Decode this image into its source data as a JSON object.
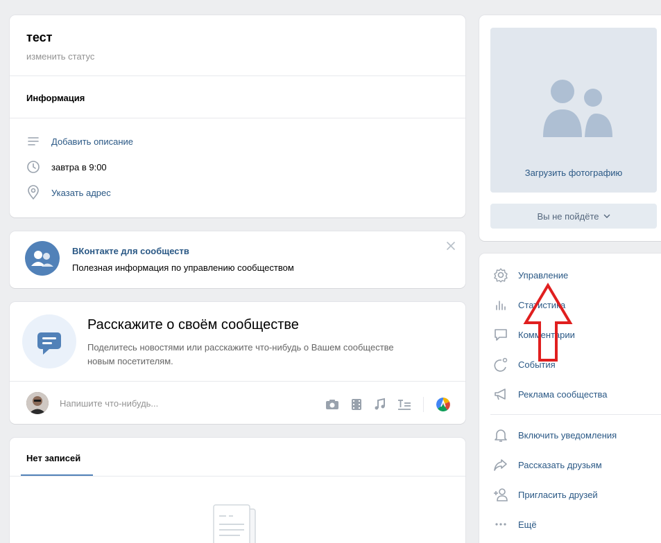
{
  "profile": {
    "name": "тест",
    "status_link": "изменить статус"
  },
  "info": {
    "header": "Информация",
    "add_description": "Добавить описание",
    "time": "завтра в 9:00",
    "add_address": "Указать адрес"
  },
  "promo": {
    "title": "ВКонтакте для сообществ",
    "subtitle": "Полезная информация по управлению сообществом"
  },
  "tell": {
    "title": "Расскажите о своём сообществе",
    "description": "Поделитесь новостями или расскажите что-нибудь о Вашем сообществе новым посетителям.",
    "composer_placeholder": "Напишите что-нибудь..."
  },
  "posts": {
    "tab_label": "Нет записей"
  },
  "photo": {
    "upload_label": "Загрузить фотографию",
    "attend_button": "Вы не пойдёте"
  },
  "menu": {
    "items": [
      {
        "label": "Управление",
        "icon": "gear-icon"
      },
      {
        "label": "Статистика",
        "icon": "stats-icon"
      },
      {
        "label": "Комментарии",
        "icon": "comment-icon"
      },
      {
        "label": "События",
        "icon": "events-icon"
      },
      {
        "label": "Реклама сообщества",
        "icon": "megaphone-icon"
      },
      {
        "label": "Включить уведомления",
        "icon": "bell-icon"
      },
      {
        "label": "Рассказать друзьям",
        "icon": "share-icon"
      },
      {
        "label": "Пригласить друзей",
        "icon": "add-user-icon"
      },
      {
        "label": "Ещё",
        "icon": "more-icon"
      }
    ]
  },
  "colors": {
    "accent": "#2a5885",
    "background": "#edeef0",
    "annotation_arrow": "#e01f1f"
  }
}
